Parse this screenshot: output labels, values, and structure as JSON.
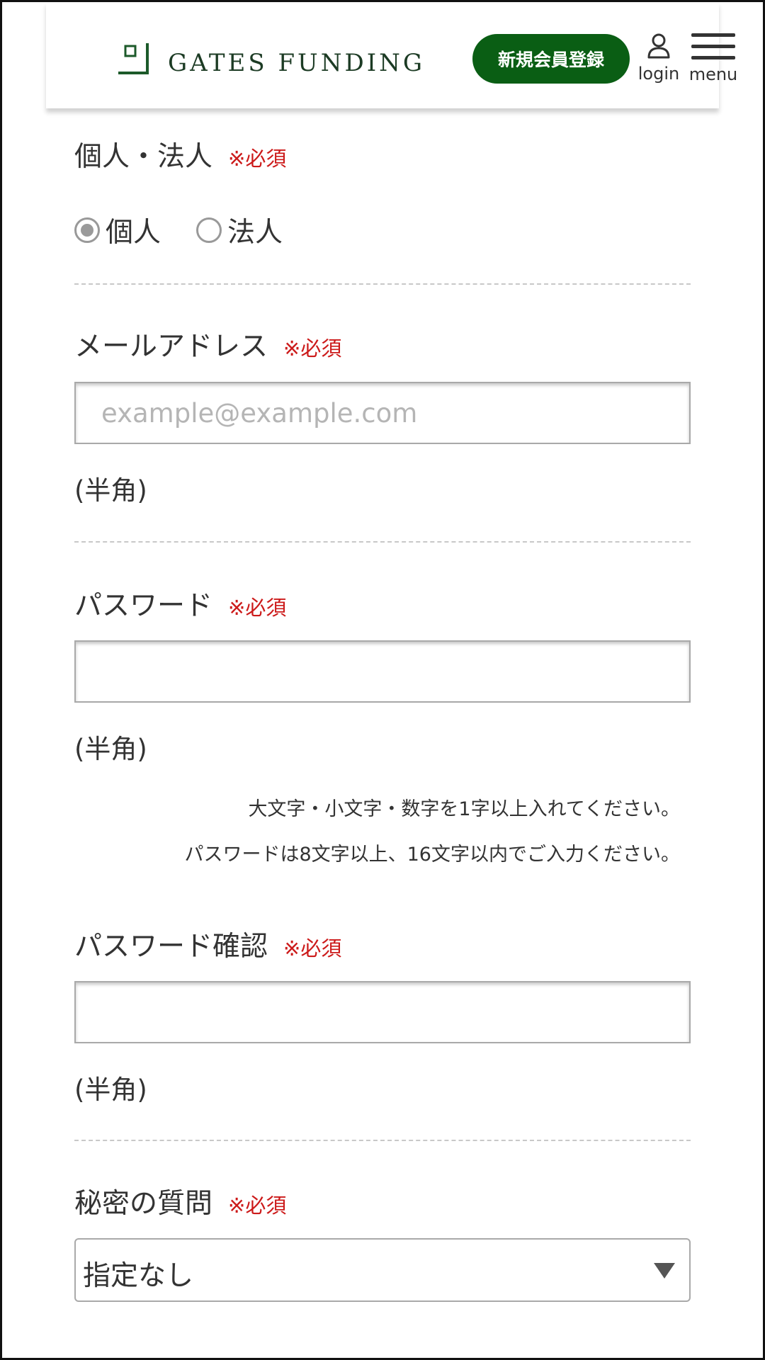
{
  "header": {
    "brand": "GATES FUNDING",
    "register_label": "新規会員登録",
    "login_label": "login",
    "menu_label": "menu",
    "brand_color": "#0a5e14"
  },
  "form": {
    "type_field": {
      "label": "個人・法人",
      "required": "※必須",
      "options": [
        {
          "label": "個人",
          "checked": true
        },
        {
          "label": "法人",
          "checked": false
        }
      ]
    },
    "email_field": {
      "label": "メールアドレス",
      "required": "※必須",
      "placeholder": "example@example.com",
      "value": "",
      "note": "(半角)"
    },
    "password_field": {
      "label": "パスワード",
      "required": "※必須",
      "value": "",
      "note": "(半角)",
      "hint1": "大文字・小文字・数字を1字以上入れてください。",
      "hint2": "パスワードは8文字以上、16文字以内でご入力ください。"
    },
    "password_confirm_field": {
      "label": "パスワード確認",
      "required": "※必須",
      "value": "",
      "note": "(半角)"
    },
    "secret_question_field": {
      "label": "秘密の質問",
      "required": "※必須",
      "selected": "指定なし"
    }
  }
}
